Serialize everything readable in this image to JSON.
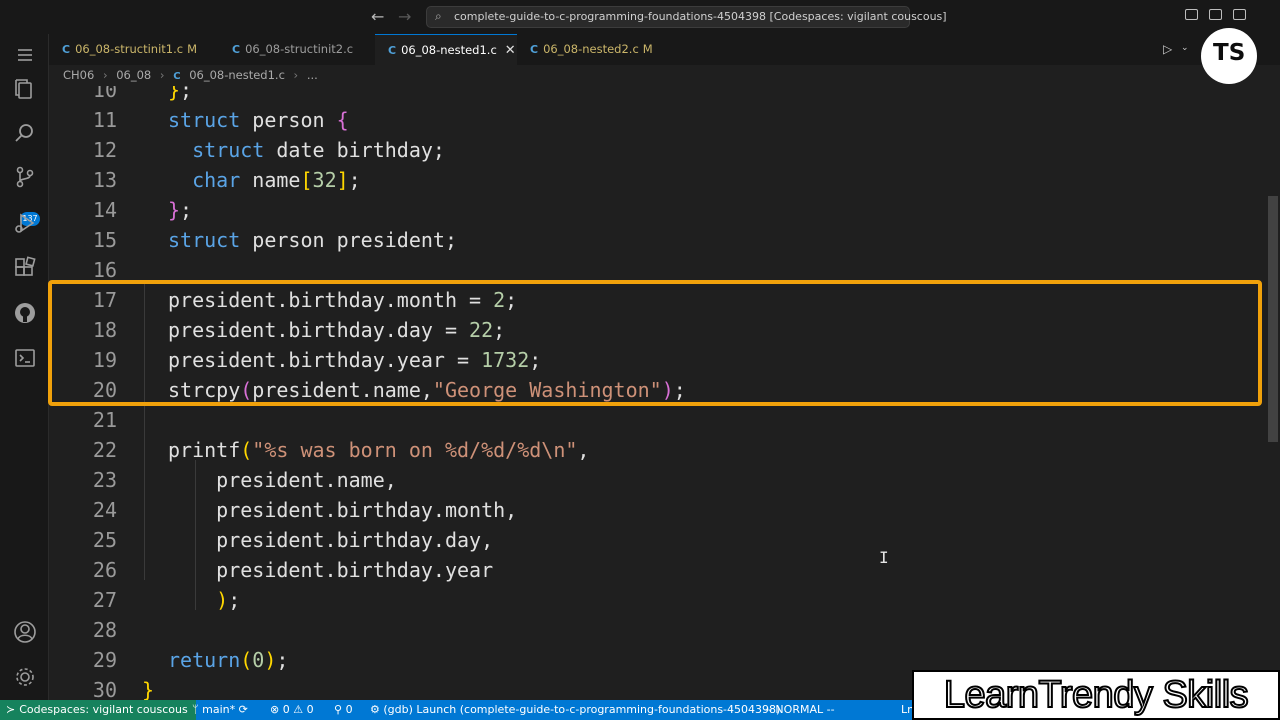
{
  "window": {
    "title": "complete-guide-to-c-programming-foundations-4504398 [Codespaces: vigilant couscous]",
    "nav_back": "←",
    "nav_forward": "→"
  },
  "tabs": [
    {
      "icon": "C",
      "label": "06_08-structinit1.c",
      "mark": "M",
      "active": false
    },
    {
      "icon": "C",
      "label": "06_08-structinit2.c",
      "mark": "",
      "active": false
    },
    {
      "icon": "C",
      "label": "06_08-nested1.c",
      "mark": "",
      "close": "✕",
      "active": true
    },
    {
      "icon": "C",
      "label": "06_08-nested2.c",
      "mark": "M",
      "active": false
    }
  ],
  "breadcrumb": {
    "items": [
      "CH06",
      "06_08",
      "C",
      "06_08-nested1.c",
      "..."
    ],
    "sep": "›"
  },
  "activity_bar": {
    "scm_badge": "137"
  },
  "editor": {
    "lines": [
      {
        "n": "10",
        "code": "};"
      },
      {
        "n": "11",
        "code": "struct person {"
      },
      {
        "n": "12",
        "code": "  struct date birthday;"
      },
      {
        "n": "13",
        "code": "  char name[32];"
      },
      {
        "n": "14",
        "code": "};"
      },
      {
        "n": "15",
        "code": "struct person president;"
      },
      {
        "n": "16",
        "code": ""
      },
      {
        "n": "17",
        "code": "president.birthday.month = 2;"
      },
      {
        "n": "18",
        "code": "president.birthday.day = 22;"
      },
      {
        "n": "19",
        "code": "president.birthday.year = 1732;"
      },
      {
        "n": "20",
        "code": "strcpy(president.name,\"George Washington\");"
      },
      {
        "n": "21",
        "code": ""
      },
      {
        "n": "22",
        "code": "printf(\"%s was born on %d/%d/%d\\n\","
      },
      {
        "n": "23",
        "code": "    president.name,"
      },
      {
        "n": "24",
        "code": "    president.birthday.month,"
      },
      {
        "n": "25",
        "code": "    president.birthday.day,"
      },
      {
        "n": "26",
        "code": "    president.birthday.year"
      },
      {
        "n": "27",
        "code": "    );"
      },
      {
        "n": "28",
        "code": ""
      },
      {
        "n": "29",
        "code": "return(0);"
      },
      {
        "n": "30",
        "code": "}"
      }
    ],
    "cursor_glyph": "I"
  },
  "statusbar": {
    "remote": "Codespaces: vigilant couscous",
    "branch": "main*",
    "problems": "0 ⚠ 0",
    "ports": "0",
    "debug": "(gdb) Launch (complete-guide-to-c-programming-foundations-4504398)",
    "mode": "-- NORMAL --",
    "ln": "Ln"
  },
  "branding": {
    "logo": "TS",
    "watermark": "LearnTrendy Skills"
  },
  "colors": {
    "highlight_box": "#f0a10b",
    "statusbar": "#0078d4",
    "remote": "#16825d",
    "keyword": "#5aa4e6",
    "string": "#ce9178",
    "number": "#b5cea8"
  }
}
